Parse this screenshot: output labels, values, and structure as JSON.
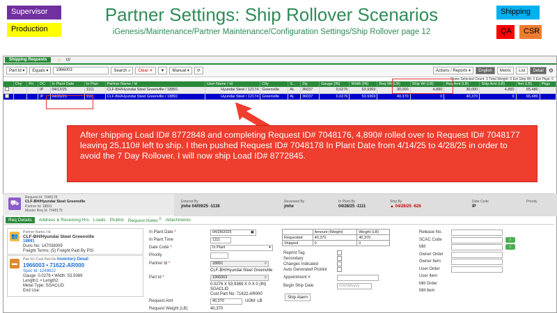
{
  "tags": {
    "supervisor": "Supervisor",
    "production": "Production",
    "shipping": "Shipping",
    "qa": "QA",
    "csr": "CSR"
  },
  "title": "Partner Settings: Ship Rollover Scenarios",
  "subtitle": "iGenesis/Maintenance/Partner Maintenance/Configuration Settings/Ship Rollover page 12",
  "tab": {
    "label": "Shipping Requests",
    "star": "☆",
    "w": "W"
  },
  "toolbar": {
    "field": "Part Id",
    "op": "Equals",
    "search_value": "1966003",
    "search": "Search",
    "clear": "Clear",
    "mode": "Manual",
    "actions": "Actions / Reports",
    "english": "English",
    "metric": "Metric",
    "list": "List",
    "detail": "Detail"
  },
  "summary": "Rows Selected Count: 0   Total Weight: 0   Est Ship Wt: 0   Est Pkgs: 0",
  "grid": {
    "headers": [
      "",
      "Chy",
      "Pri",
      "DC",
      "In Plant Date",
      "In Plan",
      "Partner Name / Id",
      "User Name / Id",
      "City",
      "S...",
      "Zip",
      "Gauge (IN)",
      "Width (IN)",
      "Req Wt (LB)",
      "Ship Wt (LB)",
      "Req Amt (LB)",
      "Ship Amt (LB)",
      "Net (LB)",
      "Pkgs"
    ],
    "rows": [
      [
        "",
        "",
        "",
        "IP",
        "04/12/25",
        "1111",
        "CLF-BH/Hyundai Steel Greenville / 18891",
        "Hyundai Steel / 12174",
        "Greenville",
        "AL",
        "36037",
        "0.0276",
        "53.9369",
        "30,000",
        "4,890",
        "30,000",
        "4,890",
        "65,480",
        ""
      ],
      [
        "",
        "",
        "",
        "IP",
        "04/28/25",
        "1111",
        "CLF-BH/Hyundai Steel Greenville / 18891",
        "Hyundai Steel / 12174",
        "Greenville",
        "AL",
        "36037",
        "0.0276",
        "53.9369",
        "40,370",
        "0",
        "40,370",
        "0",
        "65,480",
        ""
      ]
    ]
  },
  "callout": "After shipping Load ID# 8772848 and completing Request ID# 7048176, 4,890# rolled over to Request ID# 7048177 leaving 25,110# left to ship. I then pushed Request ID# 7048178 In Plant Date from 4/14/25 to 4/28/25 in order to avoid the 7 Day Rollover. I will now ship Load ID# 8772845.",
  "detail": {
    "req_id": "Request Id: 7048178",
    "partner": "CLF-BH/Hyundai Steel Greenville",
    "partner_id": "Partner Id: 18891",
    "master": "Master Req Id: 7048175",
    "entered_by_lbl": "Entered By",
    "entered_by": "jmhe 04/09/25 -1136",
    "reviewed_by_lbl": "Reviewed By",
    "reviewed_by": "jmhe",
    "in_plant_by_lbl": "In Plant By",
    "in_plant_by": "04/28/25 -1111",
    "ship_by_lbl": "Ship By",
    "ship_by": "04/28/25 -626",
    "date_code_lbl": "Date Code",
    "date_code": "IP",
    "priority_lbl": "Priority"
  },
  "subtabs": [
    "Req Details",
    "Address & Receiving Hrs",
    "Loads",
    "Picklist",
    "Request Notes",
    "Attachments"
  ],
  "request_notes_count": "0",
  "partner_card": {
    "hdr": "Partner Name / Id",
    "name": "CLF-BH/Hyundai Steel Greenville",
    "id": "18891",
    "duns": "Duns No: 147038009",
    "terms": "Freight Terms: (5) Freight Paid By PSI"
  },
  "part_card": {
    "hdr": "Part Id / Cust Part No",
    "inv": "Inventory Detail",
    "part": "1966003 • 71622-AR000",
    "spec": "Spec Id: 1249822",
    "gauge": "Gauge: 0.0276 • Width: 53.9369",
    "length": "Length1: • Length2:",
    "metal": "Metal Type: SGACLID",
    "end": "End Use:"
  },
  "form": {
    "in_plant_date_lbl": "In Plant Date",
    "in_plant_date": "04/28/2025",
    "in_plant_time_lbl": "In Plant Time",
    "in_plant_time": "1111",
    "date_code_lbl": "Date Code",
    "date_code": "In Plant",
    "priority_lbl": "Priority",
    "partner_id_lbl": "Partner Id",
    "partner_id": "18891",
    "partner_name": "CLF-BH/Hyundai Steel Greenville",
    "part_id_lbl": "Part Id",
    "part_id": "1966003",
    "part_desc": "0.0276 X 53.9369 X 0 X 0 (IN)",
    "part_metal": "SGACLID",
    "cust_part": "Cust Part No: 71622-AR000",
    "req_amt_lbl": "Request Amt",
    "req_amt": "40,370",
    "uom": "UOM: LB",
    "req_wt_lbl": "Request Weight (LB)",
    "req_wt": "40,370"
  },
  "amounts": {
    "h_amt": "Amount (Weight)",
    "h_wt": "Weight (LB)",
    "requested": "Requested",
    "req_amt": "40,370",
    "req_wt": "40,370",
    "shipped": "Shipped",
    "ship_amt": "0",
    "ship_wt": "0"
  },
  "flags": {
    "reprint": "Reprint Tag",
    "secondary": "Secondary",
    "changes": "Changes Indicated",
    "auto_pick": "Auto Generated Picklist",
    "appt": "Appointment #",
    "begin": "Begin Ship Date",
    "begin_ph": "mm/dd/yyyy",
    "alarm": "Ship Alarm"
  },
  "right_fields": [
    "Release No.",
    "SCAC Code",
    "Mill",
    "Owner Order",
    "Owner Item",
    "User Order",
    "User Item",
    "Mill Order",
    "Mill Item"
  ]
}
